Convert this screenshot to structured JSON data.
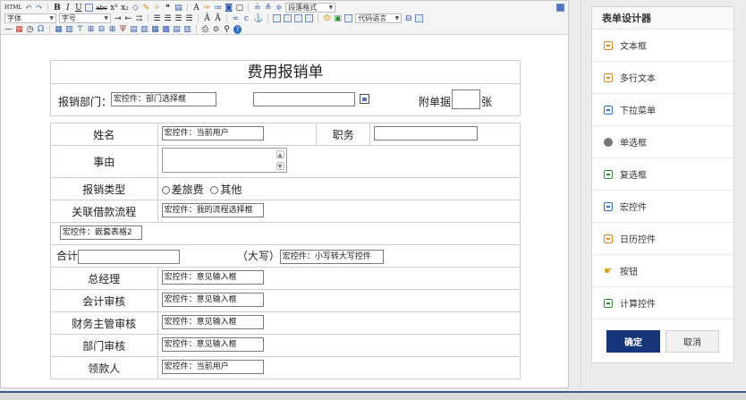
{
  "toolbar": {
    "html_label": "HTML",
    "font_family": "字体",
    "font_size": "字号",
    "paragraph_format": "段落格式",
    "code_language": "代码语言"
  },
  "form": {
    "title": "费用报销单",
    "dept_label": "报销部门：",
    "dept_control": "宏控件：部门选择框",
    "attach_label": "附单据",
    "attach_unit": "张",
    "rows": {
      "name_label": "姓名",
      "name_control": "宏控件：当前用户",
      "position_label": "职务",
      "reason_label": "事由",
      "type_label": "报销类型",
      "type_opt1": "差旅费",
      "type_opt2": "其他",
      "loan_label": "关联借款流程",
      "loan_control": "宏控件：我的流程选择框",
      "nested_control": "宏控件：嵌套表格2",
      "total_label": "合计",
      "daxie_label": "（大写）",
      "daxie_control": "宏控件：小写转大写控件",
      "gm_label": "总经理",
      "gm_control": "宏控件：意见输入框",
      "acct_label": "会计审核",
      "acct_control": "宏控件：意见输入框",
      "fin_label": "财务主管审核",
      "fin_control": "宏控件：意见输入框",
      "dept_review_label": "部门审核",
      "dept_review_control": "宏控件：意见输入框",
      "receiver_label": "领款人",
      "receiver_control": "宏控件：当前用户"
    }
  },
  "panel": {
    "title": "表单设计器",
    "items": [
      {
        "label": "文本框",
        "icon": "textbox-icon"
      },
      {
        "label": "多行文本",
        "icon": "textarea-icon"
      },
      {
        "label": "下拉菜单",
        "icon": "dropdown-icon"
      },
      {
        "label": "单选框",
        "icon": "radio-icon"
      },
      {
        "label": "复选框",
        "icon": "checkbox-icon"
      },
      {
        "label": "宏控件",
        "icon": "macro-icon"
      },
      {
        "label": "日历控件",
        "icon": "calendar-icon"
      },
      {
        "label": "按钮",
        "icon": "button-icon"
      },
      {
        "label": "计算控件",
        "icon": "calculator-icon"
      }
    ],
    "ok_label": "确定",
    "cancel_label": "取消"
  }
}
